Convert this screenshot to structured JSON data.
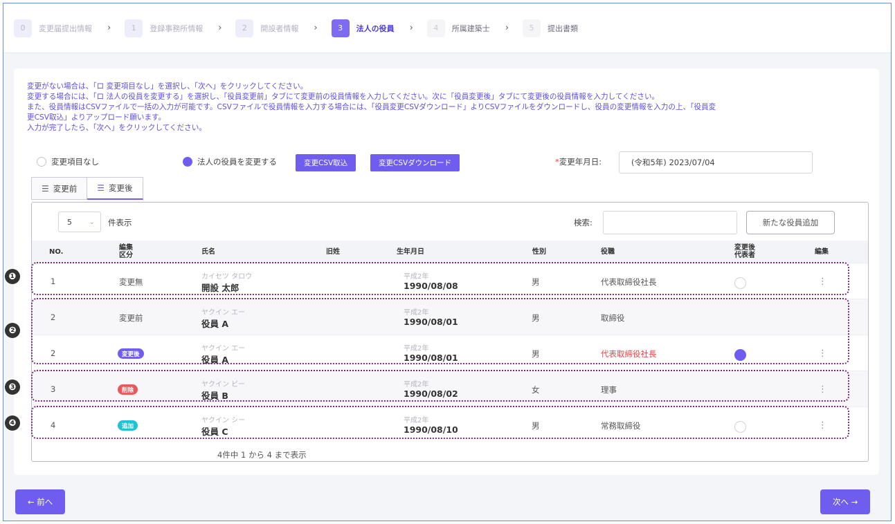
{
  "stepper": [
    {
      "num": "0",
      "label": "変更届提出情報",
      "state": "done"
    },
    {
      "num": "1",
      "label": "登録事務所情報",
      "state": "done"
    },
    {
      "num": "2",
      "label": "開設者情報",
      "state": "done"
    },
    {
      "num": "3",
      "label": "法人の役員",
      "state": "active"
    },
    {
      "num": "4",
      "label": "所属建築士",
      "state": "future"
    },
    {
      "num": "5",
      "label": "提出書類",
      "state": "future"
    }
  ],
  "stepper_sep": "›",
  "instructions": [
    "変更がない場合は、「ロ 変更項目なし」を選択し、「次へ」をクリックしてください。",
    "変更する場合には、「ロ 法人の役員を変更する」を選択し、「役員変更前」タブにて変更前の役員情報を入力してください。次に「役員変更後」タブにて変更後の役員情報を入力してください。",
    "また、役員情報はCSVファイルで一括の入力が可能です。CSVファイルで役員情報を入力する場合には、「役員変更CSVダウンロード」よりCSVファイルをダウンロードし、役員の変更情報を入力の上、「役員変",
    "更CSV取込」よりアップロード願います。",
    "入力が完了したら、「次へ」をクリックしてください。"
  ],
  "options": {
    "no_change": "変更項目なし",
    "change": "法人の役員を変更する",
    "csv_import": "変更CSV取込",
    "csv_download": "変更CSVダウンロード",
    "date_label_req": "*",
    "date_label": "変更年月日:",
    "date_value": "(令和5年)  2023/07/04"
  },
  "tabs": {
    "before": "変更前",
    "after": "変更後",
    "icon": "☰"
  },
  "table": {
    "page_size": "5",
    "page_size_caret": "⌄",
    "page_size_label": "件表示",
    "search_label": "検索:",
    "add_button": "新たな役員追加",
    "headers": {
      "no": "NO.",
      "edit_type_1": "編集",
      "edit_type_2": "区分",
      "name": "氏名",
      "former": "旧姓",
      "birth": "生年月日",
      "gender": "性別",
      "position": "役職",
      "rep_1": "変更後",
      "rep_2": "代表者",
      "edit": "編集"
    },
    "rows": [
      {
        "no": "1",
        "type": "変更無",
        "kana": "カイセツ タロウ",
        "name": "開設 太郎",
        "era": "平成2年",
        "birth": "1990/08/08",
        "gender": "男",
        "position": "代表取締役社長",
        "kebab": "⋮"
      },
      {
        "no": "2",
        "type": "変更前",
        "kana": "ヤクイン エー",
        "name": "役員 A",
        "era": "平成2年",
        "birth": "1990/08/01",
        "gender": "男",
        "position": "取締役",
        "kebab": ""
      },
      {
        "no": "2",
        "type": "変更後",
        "kana": "ヤクイン エー",
        "name": "役員 A",
        "era": "平成2年",
        "birth": "1990/08/01",
        "gender": "男",
        "position": "代表取締役社長",
        "kebab": "⋮"
      },
      {
        "no": "3",
        "type": "削除",
        "kana": "ヤクイン ビー",
        "name": "役員 B",
        "era": "平成2年",
        "birth": "1990/08/02",
        "gender": "女",
        "position": "理事",
        "kebab": "⋮"
      },
      {
        "no": "4",
        "type": "追加",
        "kana": "ヤクイン シー",
        "name": "役員 C",
        "era": "平成2年",
        "birth": "1990/08/10",
        "gender": "男",
        "position": "常務取締役",
        "kebab": "⋮"
      }
    ],
    "footer": "4件中 1 から 4 まで表示"
  },
  "markers": [
    "❶",
    "❷",
    "❸",
    "❹"
  ],
  "nav": {
    "prev": "← 前へ",
    "next": "次へ →"
  },
  "colors": {
    "accent": "#6f5df0",
    "pill_changed": "#6f5df0",
    "pill_deleted": "#e85a5a",
    "pill_added": "#1fc2d6",
    "highlight_red": "#e04545"
  }
}
